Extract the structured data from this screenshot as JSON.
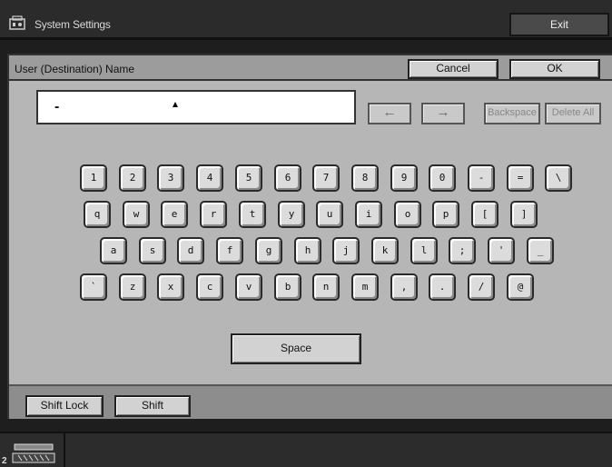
{
  "header": {
    "title": "System Settings",
    "exit_label": "Exit"
  },
  "dialog": {
    "title": "User (Destination) Name",
    "cancel_label": "Cancel",
    "ok_label": "OK"
  },
  "entry": {
    "value": "-"
  },
  "edit_buttons": {
    "left": "←",
    "right": "→",
    "backspace": "Backspace",
    "delete_all": "Delete All"
  },
  "keyboard": {
    "rows": [
      [
        "1",
        "2",
        "3",
        "4",
        "5",
        "6",
        "7",
        "8",
        "9",
        "0",
        "-",
        "=",
        "\\"
      ],
      [
        "q",
        "w",
        "e",
        "r",
        "t",
        "y",
        "u",
        "i",
        "o",
        "p",
        "[",
        "]"
      ],
      [
        "a",
        "s",
        "d",
        "f",
        "g",
        "h",
        "j",
        "k",
        "l",
        ";",
        "'",
        "_"
      ],
      [
        "`",
        "z",
        "x",
        "c",
        "v",
        "b",
        "n",
        "m",
        ",",
        ".",
        "/",
        "@"
      ]
    ],
    "space_label": "Space"
  },
  "footer": {
    "shift_lock_label": "Shift Lock",
    "shift_label": "Shift"
  },
  "status": {
    "tray_number": "2"
  },
  "icons": {
    "app": "printer-icon",
    "tray": "paper-tray-icon"
  },
  "colors": {
    "background": "#1e1e1e",
    "dialog": "#b6b6b6",
    "key": "#dcdcdc"
  }
}
